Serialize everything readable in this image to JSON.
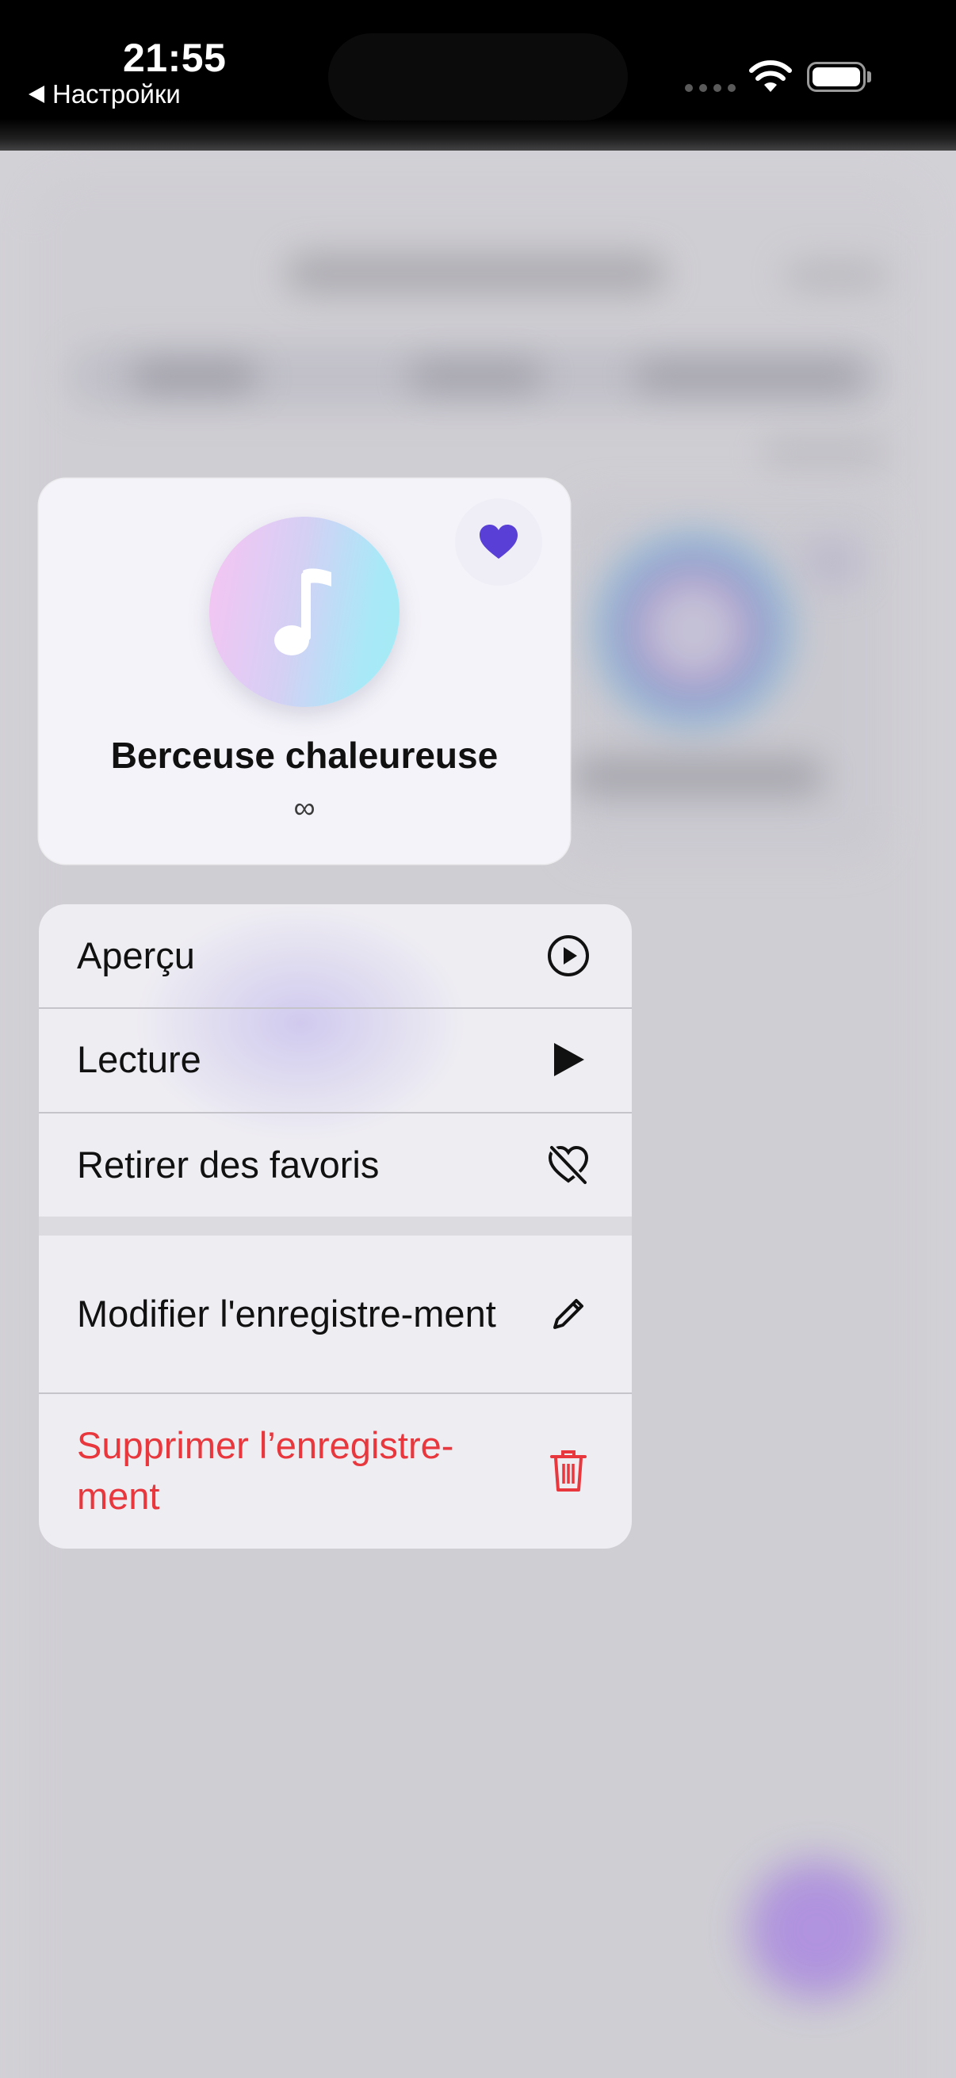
{
  "status_bar": {
    "time": "21:55",
    "back_label": "Настройки",
    "icons": [
      "signal-dots-icon",
      "wifi-icon",
      "battery-icon"
    ]
  },
  "preview": {
    "title": "Berceuse chaleureuse",
    "subtitle": "∞",
    "artwork_icon": "music-note-icon",
    "favorite_icon": "heart-filled-icon",
    "heart_color": "#5a3fd6"
  },
  "menu": {
    "items": [
      {
        "label": "Aperçu",
        "icon": "play-circle-icon"
      },
      {
        "label": "Lecture",
        "icon": "play-icon"
      },
      {
        "label": "Retirer des favoris",
        "icon": "heart-slash-icon"
      },
      {
        "label": "Modifier l'enregistre-ment",
        "icon": "pencil-icon"
      },
      {
        "label": "Supprimer l’enregistre-ment",
        "icon": "trash-icon",
        "destructive": true,
        "color": "#e8373d"
      }
    ]
  }
}
